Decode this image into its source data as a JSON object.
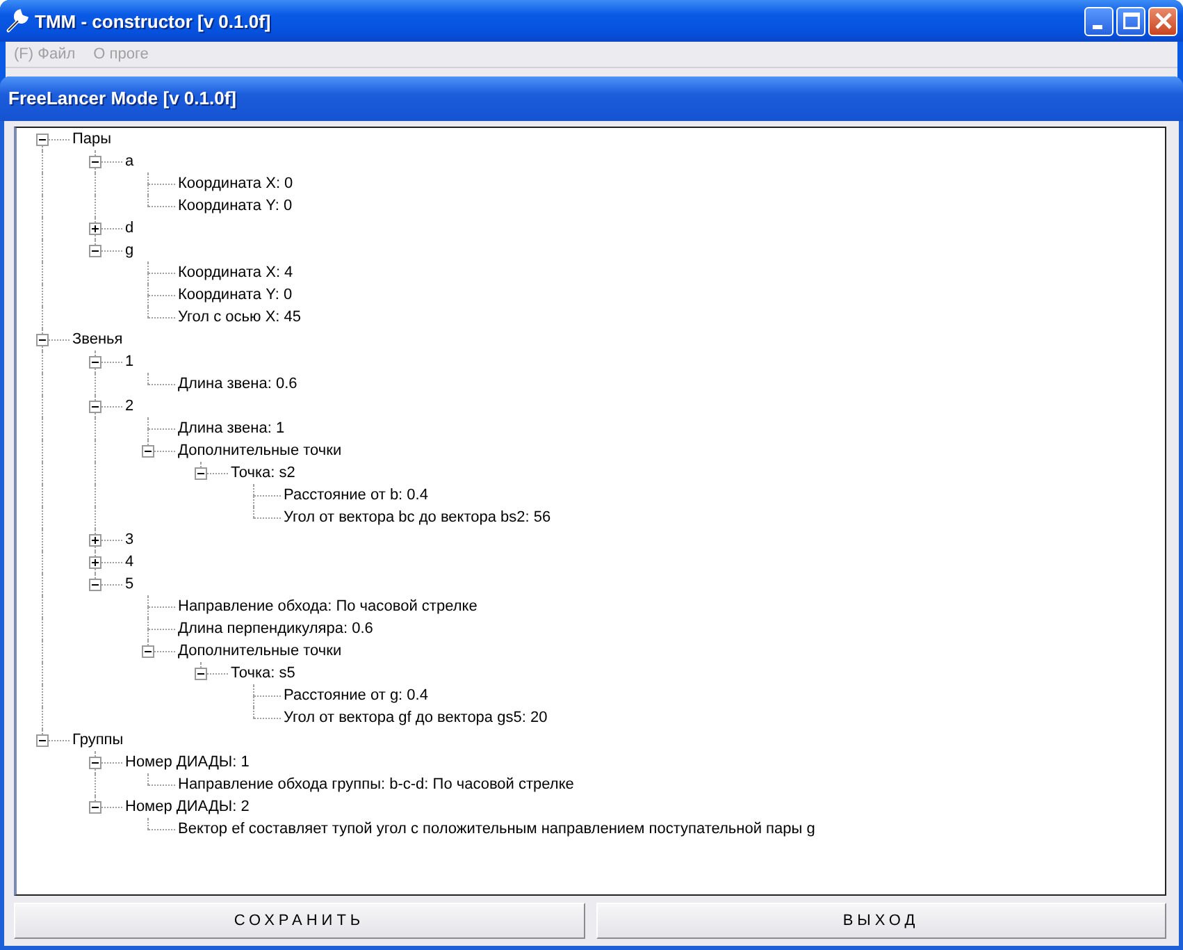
{
  "window": {
    "title": "TMM - constructor [v 0.1.0f]"
  },
  "menu": [
    {
      "label": "(F) Файл",
      "disabled": true
    },
    {
      "label": "О проге",
      "disabled": true
    }
  ],
  "panel": {
    "title": "FreeLancer Mode [v 0.1.0f]"
  },
  "tree": [
    {
      "label": "Пары",
      "expanded": true,
      "children": [
        {
          "label": "a",
          "expanded": true,
          "children": [
            {
              "label": "Координата X: 0"
            },
            {
              "label": "Координата Y: 0"
            }
          ]
        },
        {
          "label": "d",
          "expanded": false
        },
        {
          "label": "g",
          "expanded": true,
          "children": [
            {
              "label": "Координата X: 4"
            },
            {
              "label": "Координата Y: 0"
            },
            {
              "label": "Угол с осью X: 45"
            }
          ]
        }
      ]
    },
    {
      "label": "Звенья",
      "expanded": true,
      "children": [
        {
          "label": "1",
          "expanded": true,
          "children": [
            {
              "label": "Длина звена: 0.6"
            }
          ]
        },
        {
          "label": "2",
          "expanded": true,
          "children": [
            {
              "label": "Длина звена: 1"
            },
            {
              "label": "Дополнительные точки",
              "expanded": true,
              "children": [
                {
                  "label": "Точка: s2",
                  "expanded": true,
                  "children": [
                    {
                      "label": "Расстояние от b: 0.4"
                    },
                    {
                      "label": "Угол от вектора bc до вектора bs2: 56"
                    }
                  ]
                }
              ]
            }
          ]
        },
        {
          "label": "3",
          "expanded": false
        },
        {
          "label": "4",
          "expanded": false
        },
        {
          "label": "5",
          "expanded": true,
          "children": [
            {
              "label": "Направление обхода: По часовой стрелке"
            },
            {
              "label": "Длина перпендикуляра: 0.6"
            },
            {
              "label": "Дополнительные точки",
              "expanded": true,
              "children": [
                {
                  "label": "Точка: s5",
                  "expanded": true,
                  "children": [
                    {
                      "label": "Расстояние от g: 0.4"
                    },
                    {
                      "label": "Угол от вектора gf до вектора gs5: 20"
                    }
                  ]
                }
              ]
            }
          ]
        }
      ]
    },
    {
      "label": "Группы",
      "expanded": true,
      "children": [
        {
          "label": "Номер ДИАДЫ: 1",
          "expanded": true,
          "children": [
            {
              "label": "Направление обхода группы: b-c-d: По часовой стрелке"
            }
          ]
        },
        {
          "label": "Номер ДИАДЫ: 2",
          "expanded": true,
          "children": [
            {
              "label": "Вектор ef составляет тупой угол с положительным направлением поступательной пары g"
            }
          ]
        }
      ]
    }
  ],
  "buttons": [
    "СОХРАНИТЬ",
    "ВЫХОД"
  ]
}
